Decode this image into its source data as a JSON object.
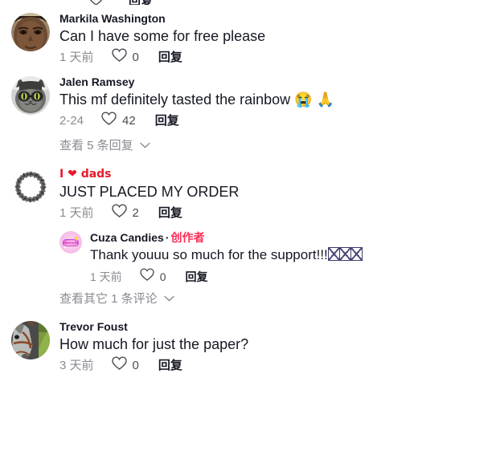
{
  "app": {
    "panel_name": "comment-list",
    "accent_color": "#fe2c55",
    "text_color": "#161823",
    "muted_color": "#8a8b91"
  },
  "labels": {
    "reply_action": "回复",
    "creator_badge": "创作者",
    "separator": "·"
  },
  "partial_top_row": {
    "reply_action": "回复",
    "like_count": ""
  },
  "comments": [
    {
      "id": "markila-washington",
      "username": "Markila Washington",
      "avatar": "face-photo-avatar",
      "text": "Can I have some for free please",
      "timestamp": "1 天前",
      "like_count": "0",
      "reply_action": "回复",
      "is_creator": false,
      "view_more": null,
      "replies": []
    },
    {
      "id": "jalen-ramsey",
      "username": "Jalen Ramsey",
      "avatar": "cat-with-glasses-avatar",
      "text": "This mf definitely tasted the rainbow 😭 🙏",
      "timestamp": "2-24",
      "like_count": "42",
      "reply_action": "回复",
      "is_creator": false,
      "view_more": "查看 5 条回复",
      "replies": []
    },
    {
      "id": "i-love-dads",
      "username": "I ❤ dads",
      "avatar": "crown-of-thorns-avatar",
      "text": "JUST PLACED MY ORDER",
      "timestamp": "1 天前",
      "like_count": "2",
      "reply_action": "回复",
      "is_creator": false,
      "view_more": "查看其它 1 条评论",
      "replies": [
        {
          "id": "cuza-candies",
          "username": "Cuza Candies",
          "avatar": "cuza-candies-logo-avatar",
          "creator_badge": "创作者",
          "text": "Thank youuu so much for the support!!!",
          "trailing_unsupported_glyphs": 3,
          "timestamp": "1 天前",
          "like_count": "0",
          "reply_action": "回复",
          "is_creator": true
        }
      ]
    },
    {
      "id": "trevor-foust",
      "username": "Trevor Foust",
      "avatar": "horse-photo-avatar",
      "text": "How much for just the paper?",
      "timestamp": "3 天前",
      "like_count": "0",
      "reply_action": "回复",
      "is_creator": false,
      "view_more": null,
      "replies": []
    }
  ]
}
